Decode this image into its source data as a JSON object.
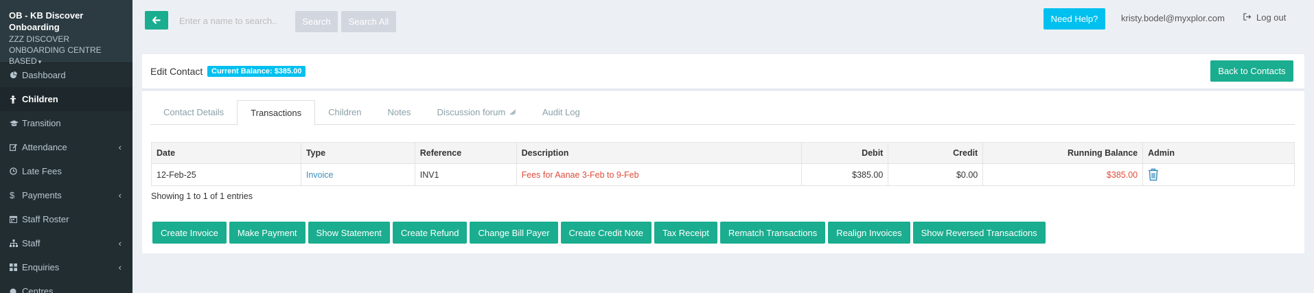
{
  "sidebar": {
    "org_name": "OB - KB Discover Onboarding",
    "centre_name": "zzz DISCOVER ONBOARDING CENTRE BASED",
    "items": [
      {
        "label": "Dashboard",
        "icon": "dashboard-icon"
      },
      {
        "label": "Children",
        "icon": "child-icon"
      },
      {
        "label": "Transition",
        "icon": "graduation-cap-icon"
      },
      {
        "label": "Attendance",
        "icon": "edit-icon"
      },
      {
        "label": "Late Fees",
        "icon": "clock-icon"
      },
      {
        "label": "Payments",
        "icon": "dollar-icon"
      },
      {
        "label": "Staff Roster",
        "icon": "calendar-icon"
      },
      {
        "label": "Staff",
        "icon": "sitemap-icon"
      },
      {
        "label": "Enquiries",
        "icon": "grid-icon"
      },
      {
        "label": "Centres",
        "icon": "circle-icon"
      }
    ]
  },
  "topbar": {
    "search_placeholder": "Enter a name to search..",
    "search_label": "Search",
    "search_all_label": "Search All",
    "help_label": "Need Help?",
    "user_email": "kristy.bodel@myxplor.com",
    "logout_label": "Log out"
  },
  "header": {
    "title": "Edit Contact",
    "balance_badge": "Current Balance: $385.00",
    "back_label": "Back to Contacts"
  },
  "tabs": [
    {
      "label": "Contact Details"
    },
    {
      "label": "Transactions"
    },
    {
      "label": "Children"
    },
    {
      "label": "Notes"
    },
    {
      "label": "Discussion forum"
    },
    {
      "label": "Audit Log"
    }
  ],
  "table": {
    "columns": {
      "date": "Date",
      "type": "Type",
      "reference": "Reference",
      "description": "Description",
      "debit": "Debit",
      "credit": "Credit",
      "running_balance": "Running Balance",
      "admin": "Admin"
    },
    "rows": [
      {
        "date": "12-Feb-25",
        "type": "Invoice",
        "reference": "INV1",
        "description": "Fees for Aanae 3-Feb to 9-Feb",
        "debit": "$385.00",
        "credit": "$0.00",
        "running_balance": "$385.00"
      }
    ],
    "entries_text": "Showing 1 to 1 of 1 entries"
  },
  "actions": [
    {
      "label": "Create Invoice"
    },
    {
      "label": "Make Payment"
    },
    {
      "label": "Show Statement"
    },
    {
      "label": "Create Refund"
    },
    {
      "label": "Change Bill Payer"
    },
    {
      "label": "Create Credit Note"
    },
    {
      "label": "Tax Receipt"
    },
    {
      "label": "Rematch Transactions"
    },
    {
      "label": "Realign Invoices"
    },
    {
      "label": "Show Reversed Transactions"
    }
  ],
  "colors": {
    "sidebar_bg": "#222d32",
    "primary_green": "#1aad8f",
    "info_cyan": "#00c0ef",
    "link_blue": "#3c8dbc",
    "danger_red": "#dd4b39"
  }
}
